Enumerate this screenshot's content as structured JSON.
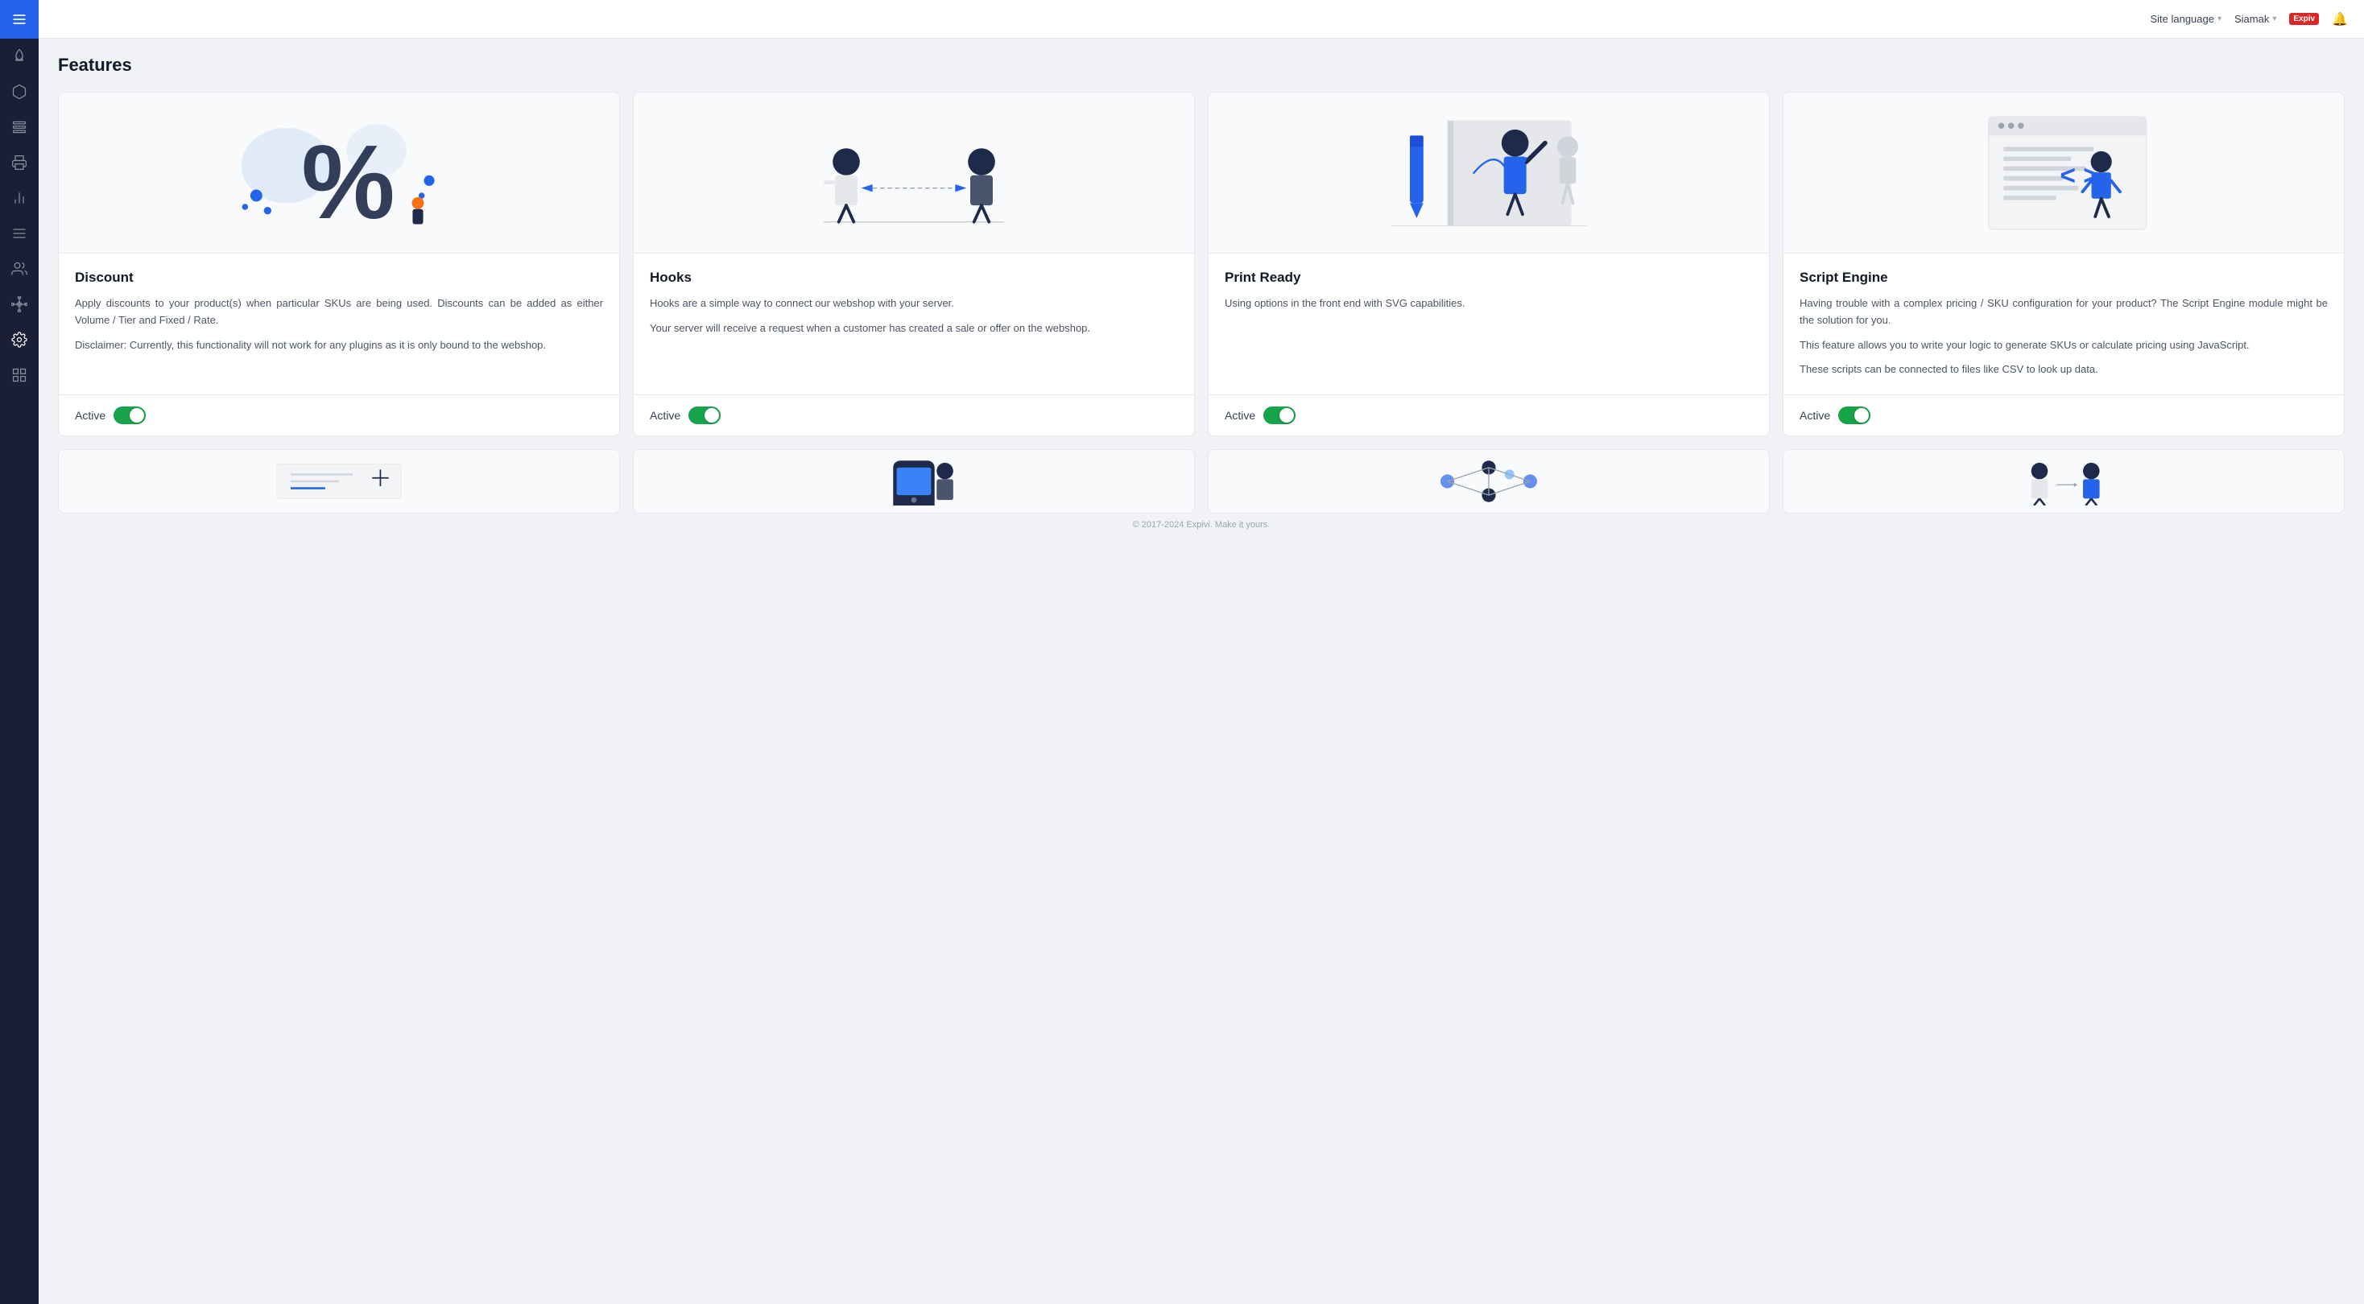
{
  "header": {
    "site_language_label": "Site language",
    "user_label": "Siamak",
    "chevron": "▾",
    "logo_text": "Expiv",
    "bell_label": "🔔"
  },
  "sidebar": {
    "menu_icon": "≡",
    "items": [
      {
        "name": "rocket",
        "icon": "🚀",
        "active": false
      },
      {
        "name": "box",
        "icon": "📦",
        "active": false
      },
      {
        "name": "list",
        "icon": "☰",
        "active": false
      },
      {
        "name": "print",
        "icon": "🖨",
        "active": false
      },
      {
        "name": "chart",
        "icon": "📊",
        "active": false
      },
      {
        "name": "lines",
        "icon": "≡",
        "active": false
      },
      {
        "name": "users",
        "icon": "👥",
        "active": false
      },
      {
        "name": "tree",
        "icon": "🌳",
        "active": false
      },
      {
        "name": "settings",
        "icon": "⚙",
        "active": true
      },
      {
        "name": "grid",
        "icon": "⊞",
        "active": false
      }
    ]
  },
  "page": {
    "title": "Features"
  },
  "cards": [
    {
      "id": "discount",
      "title": "Discount",
      "description_parts": [
        "Apply discounts to your product(s) when particular SKUs are being used. Discounts can be added as either Volume / Tier and Fixed / Rate.",
        "Disclaimer: Currently, this functionality will not work for any plugins as it is only bound to the webshop."
      ],
      "active_label": "Active",
      "active": true
    },
    {
      "id": "hooks",
      "title": "Hooks",
      "description_parts": [
        "Hooks are a simple way to connect our webshop with your server.",
        "Your server will receive a request when a customer has created a sale or offer on the webshop."
      ],
      "active_label": "Active",
      "active": true
    },
    {
      "id": "print-ready",
      "title": "Print Ready",
      "description_parts": [
        "Using options in the front end with SVG capabilities."
      ],
      "active_label": "Active",
      "active": true
    },
    {
      "id": "script-engine",
      "title": "Script Engine",
      "description_parts": [
        "Having trouble with a complex pricing / SKU configuration for your product? The Script Engine module might be the solution for you.",
        "This feature allows you to write your logic to generate SKUs or calculate pricing using JavaScript.",
        "These scripts can be connected to files like CSV to look up data."
      ],
      "active_label": "Active",
      "active": true
    }
  ],
  "footer": {
    "text": "© 2017-2024 Expivi. Make it yours."
  }
}
